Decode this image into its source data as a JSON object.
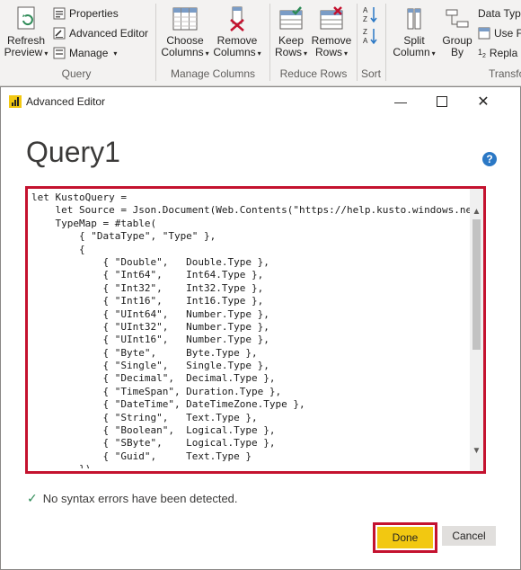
{
  "ribbon": {
    "refresh_preview": "Refresh Preview",
    "properties": "Properties",
    "advanced_editor": "Advanced Editor",
    "manage": "Manage",
    "query_group": "Query",
    "choose_columns": "Choose Columns",
    "remove_columns": "Remove Columns",
    "manage_columns_group": "Manage Columns",
    "keep_rows": "Keep Rows",
    "remove_rows": "Remove Rows",
    "reduce_rows_group": "Reduce Rows",
    "sort_group": "Sort",
    "split_column": "Split Column",
    "group_by": "Group By",
    "data_type": "Data Type",
    "use_first": "Use F",
    "replace": "Repla",
    "transform_group": "Transfo"
  },
  "dialog": {
    "window_title": "Advanced Editor",
    "query_name": "Query1",
    "help": "?",
    "status": "No syntax errors have been detected.",
    "done_label": "Done",
    "cancel_label": "Cancel",
    "code_lines": [
      "let KustoQuery =",
      "    let Source = Json.Document(Web.Contents(\"https://help.kusto.windows.net:",
      "    TypeMap = #table(",
      "        { \"DataType\", \"Type\" },",
      "        {",
      "            { \"Double\",   Double.Type },",
      "            { \"Int64\",    Int64.Type },",
      "            { \"Int32\",    Int32.Type },",
      "            { \"Int16\",    Int16.Type },",
      "            { \"UInt64\",   Number.Type },",
      "            { \"UInt32\",   Number.Type },",
      "            { \"UInt16\",   Number.Type },",
      "            { \"Byte\",     Byte.Type },",
      "            { \"Single\",   Single.Type },",
      "            { \"Decimal\",  Decimal.Type },",
      "            { \"TimeSpan\", Duration.Type },",
      "            { \"DateTime\", DateTimeZone.Type },",
      "            { \"String\",   Text.Type },",
      "            { \"Boolean\",  Logical.Type },",
      "            { \"SByte\",    Logical.Type },",
      "            { \"Guid\",     Text.Type }",
      "        }),"
    ]
  },
  "colors": {
    "highlight_border": "#c4122f",
    "done_button": "#f2c811",
    "ribbon_bg": "#f3f2f1",
    "check": "#2e8b57"
  }
}
